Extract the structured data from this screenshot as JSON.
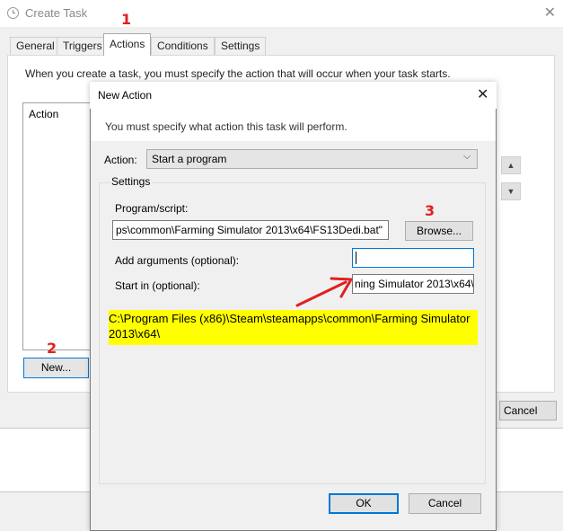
{
  "outer_window": {
    "title": "Create Task",
    "close_glyph": "✕",
    "tabs": [
      {
        "label": "General"
      },
      {
        "label": "Triggers"
      },
      {
        "label": "Actions"
      },
      {
        "label": "Conditions"
      },
      {
        "label": "Settings"
      }
    ],
    "active_tab": "Actions",
    "description": "When you create a task, you must specify the action that will occur when your task starts.",
    "action_list_header": "Action",
    "new_button": "New...",
    "move_up_glyph": "▲",
    "move_down_glyph": "▼",
    "cancel_button": "Cancel"
  },
  "dialog": {
    "title": "New Action",
    "close_glyph": "✕",
    "message": "You must specify what action this task will perform.",
    "action_label": "Action:",
    "action_value": "Start a program",
    "chevron_glyph": "⌵",
    "settings_label": "Settings",
    "program_label": "Program/script:",
    "program_value": "ps\\common\\Farming Simulator 2013\\x64\\FS13Dedi.bat\"",
    "browse_button": "Browse...",
    "args_label": "Add arguments (optional):",
    "args_value": "",
    "startin_label": "Start in (optional):",
    "startin_value": "ning Simulator 2013\\x64\\",
    "ok_button": "OK",
    "cancel_button": "Cancel"
  },
  "annotations": {
    "step1": "1",
    "step2": "2",
    "step3": "3",
    "highlight_text": "C:\\Program Files (x86)\\Steam\\steamapps\\common\\Farming Simulator 2013\\x64\\",
    "highlight_color": "#ffff00",
    "marker_color": "#e02020"
  }
}
